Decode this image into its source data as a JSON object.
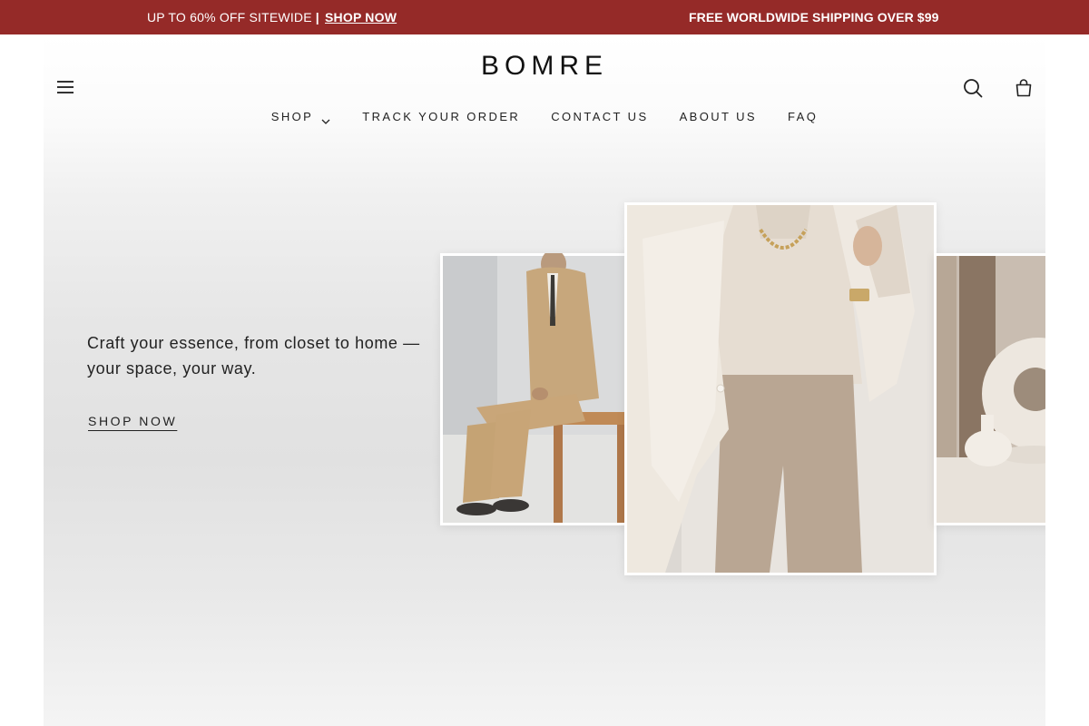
{
  "announcement": {
    "promo_text": "UP TO 60% OFF SITEWIDE",
    "separator": "|",
    "promo_link": "SHOP NOW",
    "shipping_text": "FREE WORLDWIDE SHIPPING OVER $99",
    "background_color": "#952a28"
  },
  "header": {
    "logo": "BOMRE",
    "nav": [
      {
        "label": "SHOP",
        "has_dropdown": true
      },
      {
        "label": "TRACK YOUR ORDER"
      },
      {
        "label": "CONTACT US"
      },
      {
        "label": "ABOUT US"
      },
      {
        "label": "FAQ"
      }
    ],
    "icons": [
      "menu-icon",
      "search-icon",
      "cart-icon"
    ]
  },
  "hero": {
    "tagline": "Craft your essence, from closet to home — your space, your way.",
    "cta_label": "SHOP NOW"
  }
}
